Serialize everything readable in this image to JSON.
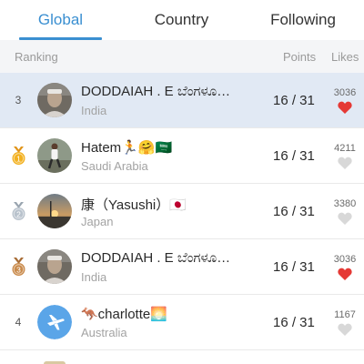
{
  "tabs": [
    {
      "label": "Global",
      "active": true
    },
    {
      "label": "Country",
      "active": false
    },
    {
      "label": "Following",
      "active": false
    }
  ],
  "header": {
    "ranking": "Ranking",
    "points": "Points",
    "likes": "Likes"
  },
  "rows": [
    {
      "rank": "3",
      "medal": null,
      "avatar": "photo-elderly-man",
      "name": "DODDAIAH . E ಬೆಂಗಳೂ…",
      "country": "India",
      "points": "16 / 31",
      "likes": "3036",
      "liked": true,
      "highlight": true
    },
    {
      "rank": "1",
      "medal": "gold",
      "avatar": "photo-runner",
      "name": "Hatem🏃🤗🇸🇦",
      "country": "Saudi Arabia",
      "points": "16 / 31",
      "likes": "4211",
      "liked": false,
      "highlight": false
    },
    {
      "rank": "2",
      "medal": "silver",
      "avatar": "photo-sunset",
      "name": "康（Yasushi）🇯🇵",
      "country": "Japan",
      "points": "16 / 31",
      "likes": "3380",
      "liked": false,
      "highlight": false
    },
    {
      "rank": "3",
      "medal": "bronze",
      "avatar": "photo-elderly-man",
      "name": "DODDAIAH . E ಬೆಂಗಳೂ…",
      "country": "India",
      "points": "16 / 31",
      "likes": "3036",
      "liked": true,
      "highlight": false
    },
    {
      "rank": "4",
      "medal": null,
      "avatar": "airplane-icon",
      "name": "🦘charlotte🌅",
      "country": "Australia",
      "points": "16 / 31",
      "likes": "1167",
      "liked": false,
      "highlight": false
    }
  ],
  "colors": {
    "accent": "#3a8fd1",
    "liked_heart": "#e53935",
    "unliked_heart": "#d8d8d8",
    "highlight_row": "#e1e9f4",
    "gold": "#f2b01e",
    "silver": "#b8c2cc",
    "bronze": "#c98a4b"
  }
}
